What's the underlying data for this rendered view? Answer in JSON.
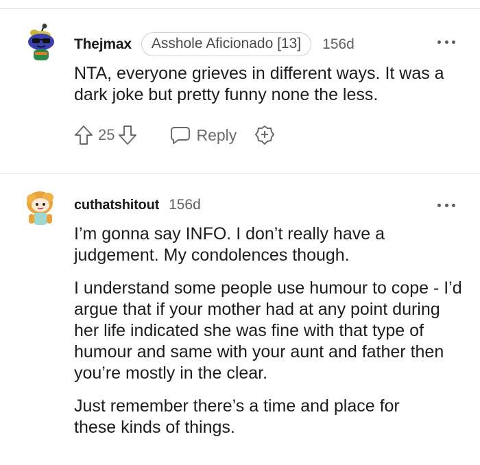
{
  "comments": [
    {
      "username": "Thejmax",
      "flair": "Asshole Aficionado [13]",
      "age": "156d",
      "paragraphs": [
        "NTA, everyone grieves in different ways. It was a dark joke but pretty funny none the less."
      ],
      "votes": "25",
      "reply_label": "Reply",
      "avatar_icon": "snoo-avatar-sunglasses-icon"
    },
    {
      "username": "cuthatshitout",
      "age": "156d",
      "paragraphs": [
        "I’m gonna say INFO. I don’t really have a judgement. My condolences though.",
        "I understand some people use humour to cope - I’d argue that if your mother had at any point during her life indicated she was fine with that type of humour and same with your aunt and father then you’re mostly in the clear.",
        "Just remember there’s a time and place for these kinds of things."
      ],
      "avatar_icon": "snoo-avatar-blonde-icon"
    }
  ],
  "colors": {
    "text": "#1c1c1c",
    "muted": "#6b6b6b",
    "divider": "#e3e3e3"
  }
}
